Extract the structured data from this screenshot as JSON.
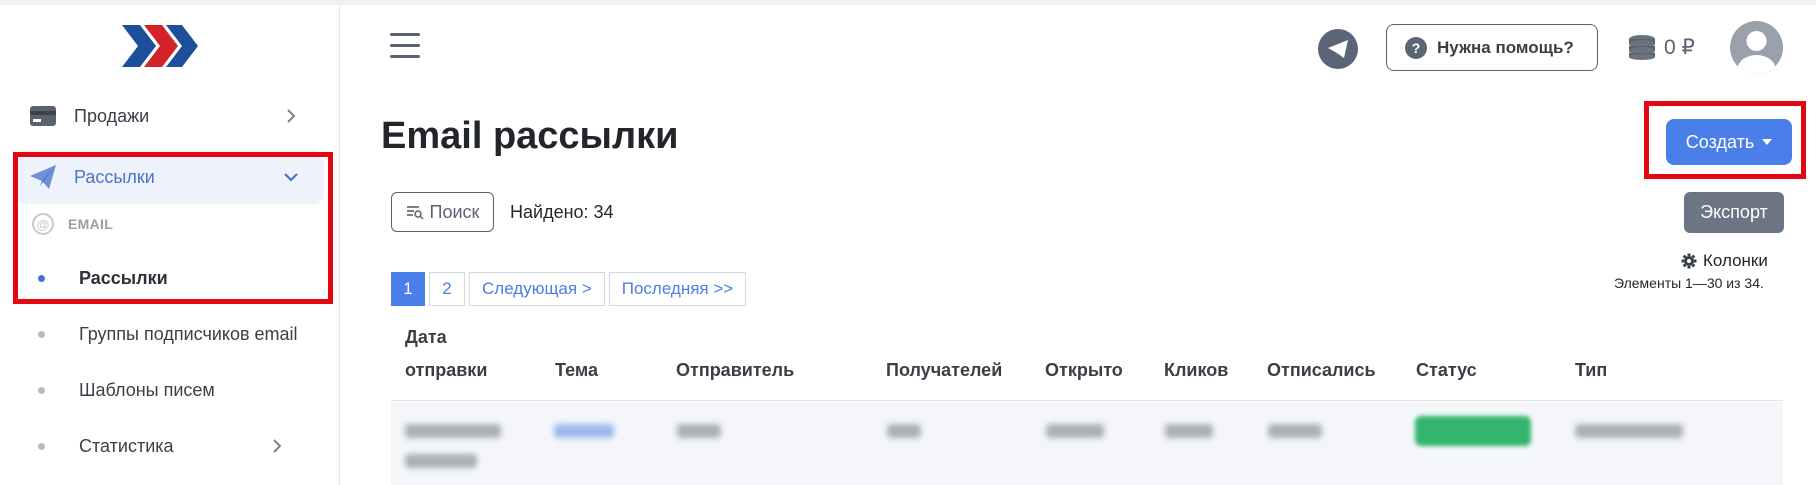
{
  "sidebar": {
    "items": [
      {
        "label": "Продажи"
      },
      {
        "label": "Рассылки"
      }
    ],
    "subhead": "EMAIL",
    "subitems": [
      {
        "label": "Рассылки"
      },
      {
        "label": "Группы подписчиков email"
      },
      {
        "label": "Шаблоны писем"
      },
      {
        "label": "Статистика"
      }
    ]
  },
  "header": {
    "help_label": "Нужна помощь?",
    "balance": "0 ₽"
  },
  "main": {
    "title": "Email рассылки",
    "create_label": "Создать",
    "search_label": "Поиск",
    "found_text": "Найдено: 34",
    "export_label": "Экспорт",
    "columns_label": "Колонки",
    "items_info": "Элементы 1—30 из 34."
  },
  "pagination": {
    "pages": [
      "1",
      "2"
    ],
    "next_label": "Следующая >",
    "last_label": "Последняя >>"
  },
  "table": {
    "headers": {
      "date_line1": "Дата",
      "date_line2": "отправки",
      "subject": "Тема",
      "sender": "Отправитель",
      "recipients": "Получателей",
      "opened": "Открыто",
      "clicks": "Кликов",
      "unsubscribed": "Отписались",
      "status": "Статус",
      "type": "Тип"
    }
  },
  "colors": {
    "accent": "#4a7ee8",
    "active_nav_bg": "#eef2fb",
    "highlight_box": "#e30613",
    "export_bg": "#6c7584",
    "status_green": "#33b56c"
  },
  "icons": {
    "logo": "chevrons-logo",
    "sales": "card-icon",
    "mailings": "paper-plane-icon",
    "email": "at-icon",
    "menu": "hamburger-icon",
    "telegram": "telegram-icon",
    "help": "question-icon",
    "balance": "coins-icon",
    "avatar": "user-icon",
    "columns": "gear-icon"
  }
}
